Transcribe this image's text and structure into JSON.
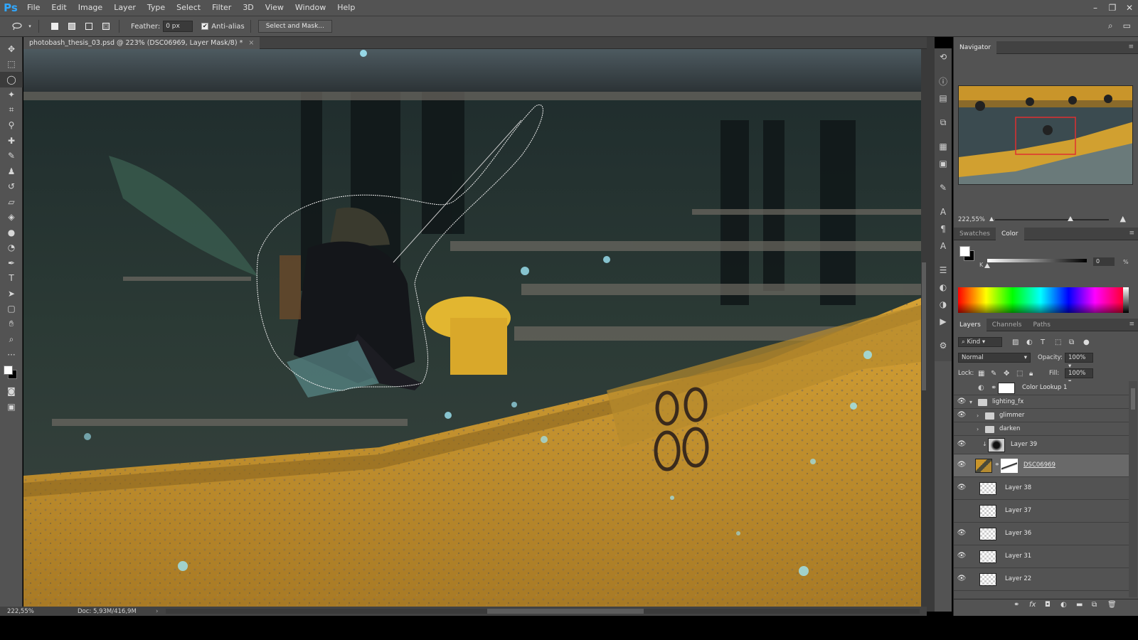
{
  "app": {
    "logo": "Ps"
  },
  "menu": [
    "File",
    "Edit",
    "Image",
    "Layer",
    "Type",
    "Select",
    "Filter",
    "3D",
    "View",
    "Window",
    "Help"
  ],
  "window_controls": [
    "–",
    "❐",
    "✕"
  ],
  "options": {
    "feather_label": "Feather:",
    "feather_value": "0 px",
    "antialias_label": "Anti-alias",
    "antialias_checked": "✔",
    "select_mask_label": "Select and Mask..."
  },
  "document": {
    "tab_title": "photobash_thesis_03.psd @ 223% (DSC06969, Layer Mask/8) *",
    "close": "×"
  },
  "status": {
    "zoom": "222,55%",
    "doc": "Doc: 5,93M/416,9M",
    "arrow": "›"
  },
  "navigator": {
    "tab": "Navigator",
    "zoom": "222,55%",
    "zoom_slider_fraction": 0.66
  },
  "color_panel": {
    "tabs": [
      "Swatches",
      "Color"
    ],
    "active_tab": "Color",
    "k_label": "K",
    "k_value": "0",
    "pct": "%",
    "slider_fraction": 0.0
  },
  "layers_panel": {
    "tabs": [
      "Layers",
      "Channels",
      "Paths"
    ],
    "kind_label": "Kind",
    "blend_mode": "Normal",
    "opacity_label": "Opacity:",
    "opacity_value": "100%",
    "lock_label": "Lock:",
    "fill_label": "Fill:",
    "fill_value": "100%",
    "layers": [
      {
        "name": "Color Lookup 1",
        "visible": false,
        "type": "adjustment"
      },
      {
        "name": "lighting_fx",
        "visible": true,
        "type": "group-open"
      },
      {
        "name": "glimmer",
        "visible": true,
        "type": "group"
      },
      {
        "name": "darken",
        "visible": false,
        "type": "group"
      },
      {
        "name": "Layer 39",
        "visible": true,
        "type": "clipped"
      },
      {
        "name": "DSC06969",
        "visible": true,
        "type": "masked",
        "selected": true
      },
      {
        "name": "Layer 38",
        "visible": true,
        "type": "pixel"
      },
      {
        "name": "Layer 37",
        "visible": false,
        "type": "pixel"
      },
      {
        "name": "Layer 36",
        "visible": true,
        "type": "pixel"
      },
      {
        "name": "Layer 31",
        "visible": true,
        "type": "pixel"
      },
      {
        "name": "Layer 22",
        "visible": true,
        "type": "pixel"
      }
    ]
  },
  "colors": {
    "ui_dark": "#535353",
    "ui_darker": "#424242",
    "accent_ps": "#31a8ff",
    "canvas_yellow": "#c9952a",
    "nav_view_box": "#e03030"
  },
  "icons": {
    "tools": [
      "move-icon",
      "marquee-icon",
      "lasso-icon",
      "magic-wand-icon",
      "crop-icon",
      "eyedropper-icon",
      "healing-brush-icon",
      "brush-icon",
      "clone-stamp-icon",
      "history-brush-icon",
      "eraser-icon",
      "paint-bucket-icon",
      "blur-icon",
      "dodge-icon",
      "pen-icon",
      "type-icon",
      "path-select-icon",
      "rectangle-icon",
      "hand-icon",
      "zoom-icon",
      "more-icon"
    ]
  }
}
